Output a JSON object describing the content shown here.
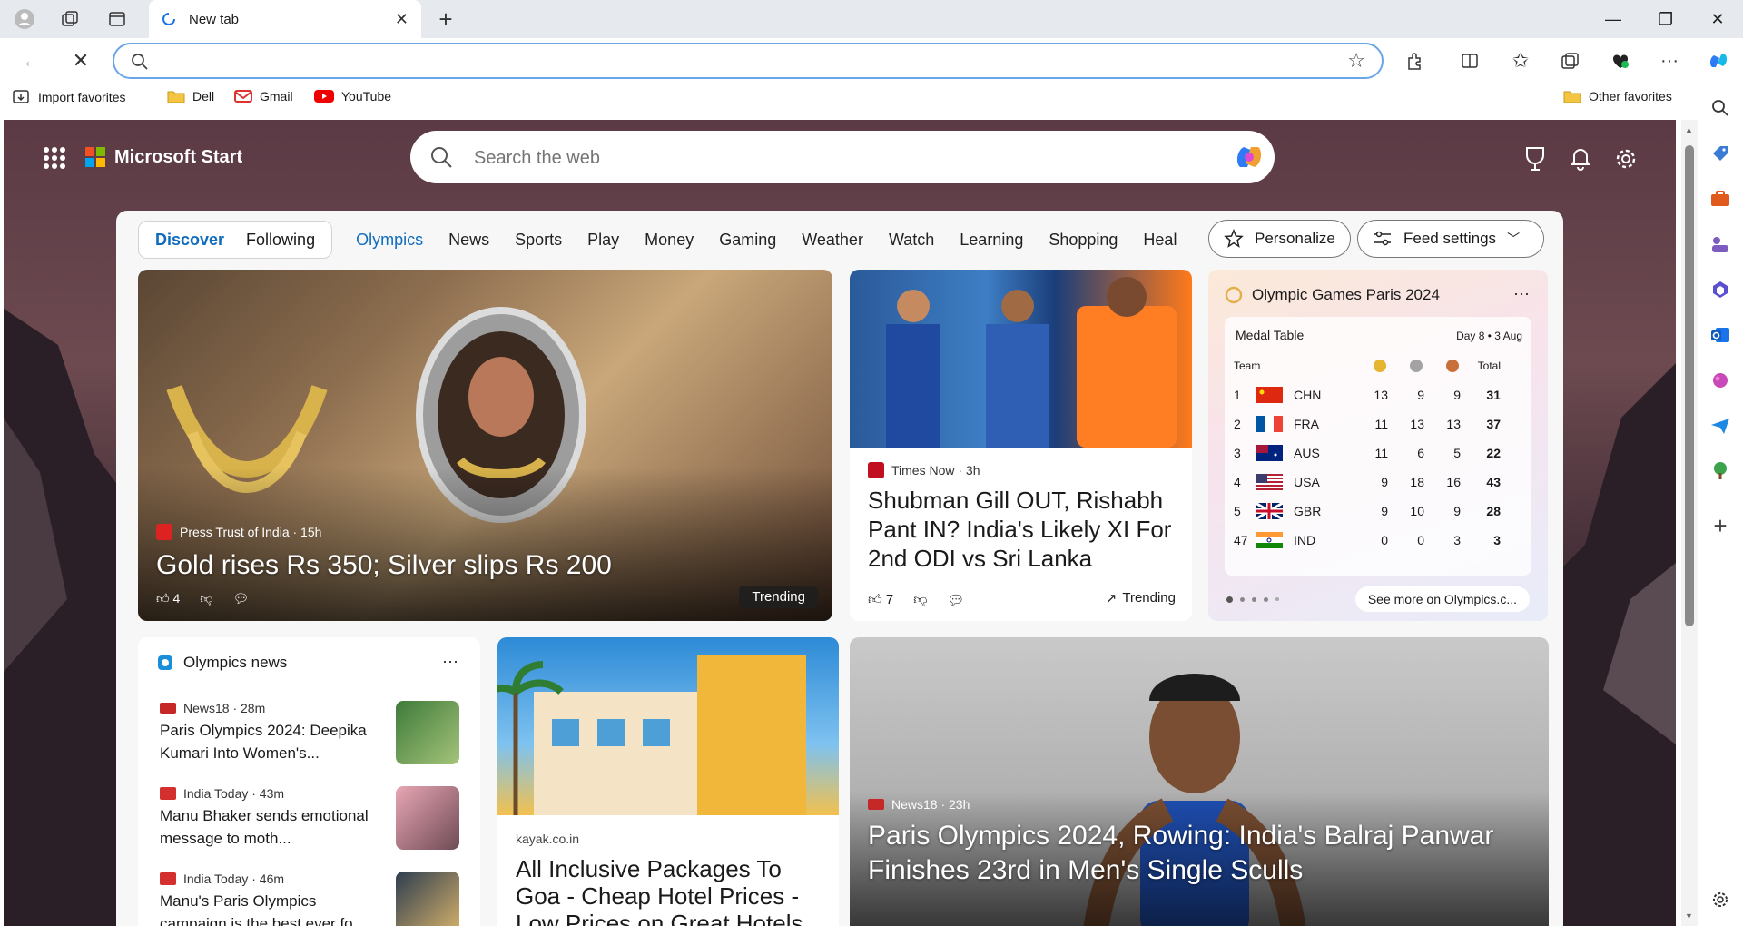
{
  "browser": {
    "tab_title": "New tab",
    "address_value": "",
    "bookmarks": [
      "Import favorites",
      "Dell",
      "Gmail",
      "YouTube"
    ],
    "other_favorites": "Other favorites"
  },
  "header": {
    "brand": "Microsoft Start",
    "search_placeholder": "Search the web"
  },
  "nav": {
    "segment": [
      "Discover",
      "Following"
    ],
    "links": [
      "Olympics",
      "News",
      "Sports",
      "Play",
      "Money",
      "Gaming",
      "Weather",
      "Watch",
      "Learning",
      "Shopping",
      "Heal"
    ],
    "personalize": "Personalize",
    "feed_settings": "Feed settings"
  },
  "hero": {
    "source": "Press Trust of India · 15h",
    "headline": "Gold rises Rs 350; Silver slips Rs 200",
    "likes": "4",
    "badge": "Trending"
  },
  "card2": {
    "source": "Times Now · 3h",
    "headline": "Shubman Gill OUT, Rishabh Pant IN? India's Likely XI For 2nd ODI vs Sri Lanka",
    "likes": "7",
    "trending": "Trending"
  },
  "medal": {
    "title": "Olympic Games Paris 2024",
    "table_label": "Medal Table",
    "day": "Day 8 • 3 Aug",
    "col_team": "Team",
    "col_total": "Total",
    "rows": [
      {
        "rank": "1",
        "code": "CHN",
        "g": "13",
        "s": "9",
        "b": "9",
        "t": "31"
      },
      {
        "rank": "2",
        "code": "FRA",
        "g": "11",
        "s": "13",
        "b": "13",
        "t": "37"
      },
      {
        "rank": "3",
        "code": "AUS",
        "g": "11",
        "s": "6",
        "b": "5",
        "t": "22"
      },
      {
        "rank": "4",
        "code": "USA",
        "g": "9",
        "s": "18",
        "b": "16",
        "t": "43"
      },
      {
        "rank": "5",
        "code": "GBR",
        "g": "9",
        "s": "10",
        "b": "9",
        "t": "28"
      },
      {
        "rank": "47",
        "code": "IND",
        "g": "0",
        "s": "0",
        "b": "3",
        "t": "3"
      }
    ],
    "see_more": "See more on Olympics.c..."
  },
  "olympics_news": {
    "title": "Olympics news",
    "items": [
      {
        "source": "News18 · 28m",
        "headline": "Paris Olympics 2024: Deepika Kumari Into Women's..."
      },
      {
        "source": "India Today · 43m",
        "headline": "Manu Bhaker sends emotional message to moth..."
      },
      {
        "source": "India Today · 46m",
        "headline": "Manu's Paris Olympics campaign is the best ever fo..."
      }
    ]
  },
  "ad": {
    "source": "kayak.co.in",
    "headline": "All Inclusive Packages To Goa - Cheap Hotel Prices - Low Prices on Great Hotels"
  },
  "rowing": {
    "source": "News18 · 23h",
    "headline": "Paris Olympics 2024, Rowing: India's Balraj Panwar Finishes 23rd in Men's Single Sculls"
  }
}
